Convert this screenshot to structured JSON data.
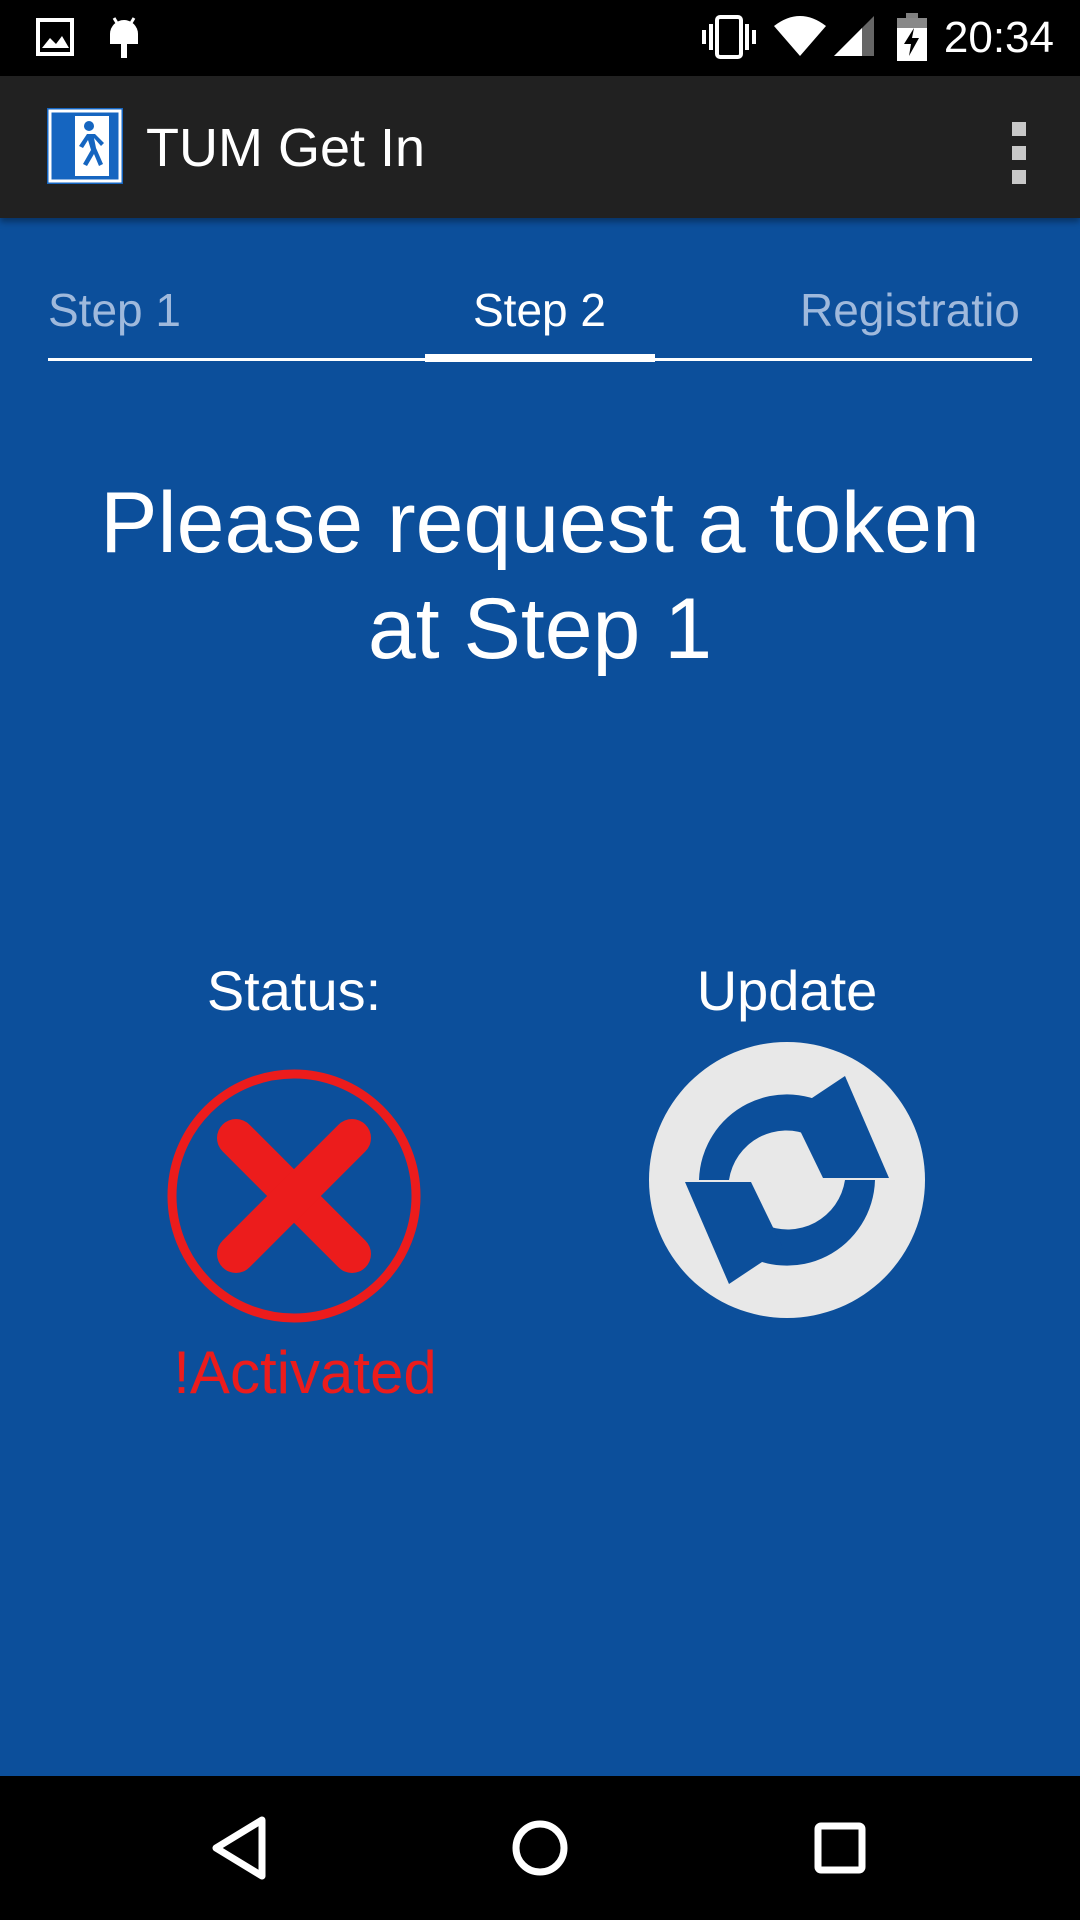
{
  "status_bar": {
    "time": "20:34",
    "icons": [
      "image-notification-icon",
      "android-notification-icon",
      "vibrate-icon",
      "wifi-icon",
      "cell-signal-icon",
      "battery-charging-icon"
    ]
  },
  "app_bar": {
    "title": "TUM Get In",
    "app_icon": "emergency-exit-icon",
    "overflow_icon": "overflow-menu-icon"
  },
  "tabs": {
    "items": [
      {
        "label": "Step 1",
        "selected": false
      },
      {
        "label": "Step 2",
        "selected": true
      },
      {
        "label": "Registratio",
        "selected": false
      }
    ]
  },
  "main": {
    "message_line1": "Please request a token",
    "message_line2": "at Step 1",
    "status_label": "Status:",
    "status_icon": "error-x-icon",
    "status_value": "!Activated",
    "update_label": "Update",
    "update_icon": "refresh-icon"
  },
  "nav_bar": {
    "buttons": [
      "back-icon",
      "home-icon",
      "recents-icon"
    ]
  },
  "colors": {
    "background": "#0c4f9b",
    "app_bar": "#212121",
    "error_red": "#ec1c1c",
    "refresh_bg": "#e8e8e8",
    "tab_inactive": "#9fb9dc"
  }
}
